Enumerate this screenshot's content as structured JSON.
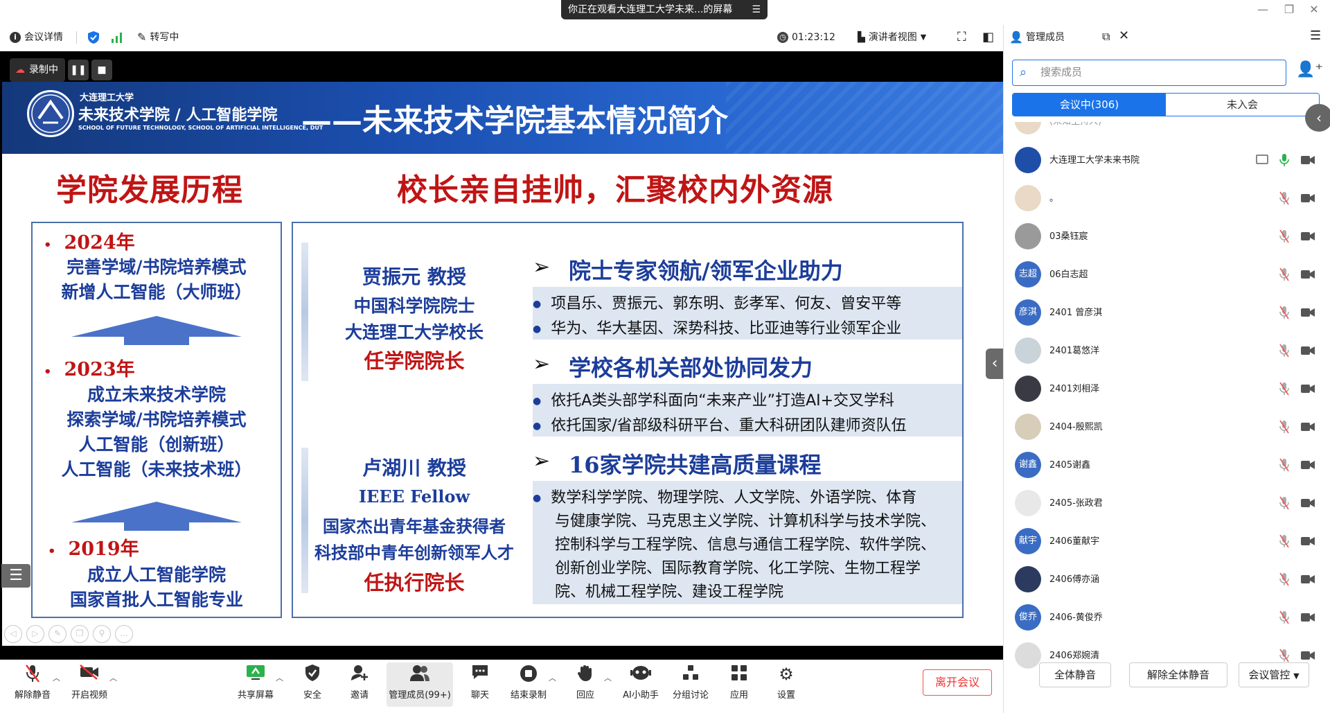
{
  "share_banner": {
    "text": "你正在观看大连理工大学未来...的屏幕",
    "menu_icon": "menu-icon"
  },
  "toolbar": {
    "meeting_details": "会议详情",
    "transcribe": "转写中",
    "timer": "01:23:12",
    "presenter_view": "演讲者视图",
    "panel_title": "管理成员"
  },
  "recording": {
    "label": "录制中"
  },
  "slide": {
    "school_small": "大连理工大学",
    "school_name": "未来技术学院 / 人工智能学院",
    "school_en": "SCHOOL OF FUTURE TECHNOLOGY, SCHOOL OF ARTIFICIAL INTELLIGENCE, DUT",
    "header_title": "——未来技术学院基本情况简介",
    "left_title": "学院发展历程",
    "right_title": "校长亲自挂帅，汇聚校内外资源",
    "timeline": [
      {
        "year": "2024年",
        "lines": [
          "完善学域/书院培养模式",
          "新增人工智能（大师班）"
        ]
      },
      {
        "year": "2023年",
        "lines": [
          "成立未来技术学院",
          "探索学域/书院培养模式",
          "人工智能（创新班）",
          "人工智能（未来技术班）"
        ]
      },
      {
        "year": "2019年",
        "lines": [
          "成立人工智能学院",
          "国家首批人工智能专业"
        ]
      }
    ],
    "leaders": [
      {
        "name": "贾振元  教授",
        "lines": [
          "中国科学院院士",
          "大连理工大学校长"
        ],
        "role": "任学院院长"
      },
      {
        "name": "卢湖川  教授",
        "lines": [
          "IEEE Fellow",
          "国家杰出青年基金获得者",
          "科技部中青年创新领军人才"
        ],
        "role": "任执行院长"
      }
    ],
    "sections": [
      {
        "title": "院士专家领航/领军企业助力",
        "bullets": [
          "项昌乐、贾振元、郭东明、彭孝军、何友、曾安平等",
          "华为、华大基因、深势科技、比亚迪等行业领军企业"
        ]
      },
      {
        "title": "学校各机关部处协同发力",
        "bullets": [
          "依托A类头部学科面向“未来产业”打造AI+交叉学科",
          "依托国家/省部级科研平台、重大科研团队建师资队伍"
        ]
      },
      {
        "title": "16家学院共建高质量课程",
        "paragraph": [
          "数学科学学院、物理学院、人文学院、外语学院、体育",
          "与健康学院、马克思主义学院、计算机科学与技术学院、",
          "控制科学与工程学院、信息与通信工程学院、软件学院、",
          "创新创业学院、国际教育学院、化工学院、生物工程学",
          "院、机械工程学院、建设工程学院"
        ]
      }
    ]
  },
  "bottombar": {
    "unmute": "解除静音",
    "start_video": "开启视频",
    "share_screen": "共享屏幕",
    "security": "安全",
    "invite": "邀请",
    "manage_members": "管理成员(99+)",
    "chat": "聊天",
    "end_recording": "结束录制",
    "reactions": "回应",
    "ai_assistant": "AI小助手",
    "breakout": "分组讨论",
    "apps": "应用",
    "settings": "设置",
    "leave": "离开会议"
  },
  "panel": {
    "search_placeholder": "搜索成员",
    "tab_in_meeting": "会议中(306)",
    "tab_not_joined": "未入会",
    "partial_name": "(未知主持人)",
    "members": [
      {
        "name": "大连理工大学未来书院",
        "avatar_text": "",
        "avatar_color": "#1f4ea8",
        "mic": "on",
        "screen": true
      },
      {
        "name": "。",
        "avatar_text": "",
        "avatar_color": "#e9d9c6",
        "mic": "off",
        "screen": false
      },
      {
        "name": "03桑钰宸",
        "avatar_text": "",
        "avatar_color": "#9a9a9a",
        "mic": "off",
        "screen": false
      },
      {
        "name": "06白志超",
        "avatar_text": "志超",
        "avatar_color": "#3b6cc4",
        "mic": "off",
        "screen": false
      },
      {
        "name": "2401 曾彦淇",
        "avatar_text": "彦淇",
        "avatar_color": "#3b6cc4",
        "mic": "off",
        "screen": false
      },
      {
        "name": "2401葛悠洋",
        "avatar_text": "",
        "avatar_color": "#c9d3da",
        "mic": "off",
        "screen": false
      },
      {
        "name": "2401刘相泽",
        "avatar_text": "",
        "avatar_color": "#3a3a44",
        "mic": "off",
        "screen": false
      },
      {
        "name": "2404-殷熙凯",
        "avatar_text": "",
        "avatar_color": "#d8cdb8",
        "mic": "off",
        "screen": false
      },
      {
        "name": "2405谢鑫",
        "avatar_text": "谢鑫",
        "avatar_color": "#3b6cc4",
        "mic": "off",
        "screen": false
      },
      {
        "name": "2405-张政君",
        "avatar_text": "",
        "avatar_color": "#e8e8e8",
        "mic": "off",
        "screen": false
      },
      {
        "name": "2406董献宇",
        "avatar_text": "献宇",
        "avatar_color": "#3b6cc4",
        "mic": "off",
        "screen": false
      },
      {
        "name": "2406傅亦涵",
        "avatar_text": "",
        "avatar_color": "#2b3a5e",
        "mic": "off",
        "screen": false
      },
      {
        "name": "2406-黄俊乔",
        "avatar_text": "俊乔",
        "avatar_color": "#3b6cc4",
        "mic": "off",
        "screen": false
      },
      {
        "name": "2406郑婉清",
        "avatar_text": "",
        "avatar_color": "#dcdcdc",
        "mic": "off",
        "screen": false
      }
    ],
    "mute_all": "全体静音",
    "unmute_all": "解除全体静音",
    "meeting_control": "会议管控"
  },
  "colors": {
    "accent": "#1a73e8",
    "slide_red": "#c01515",
    "slide_blue": "#1c3d9a",
    "leave_red": "#e33333"
  }
}
